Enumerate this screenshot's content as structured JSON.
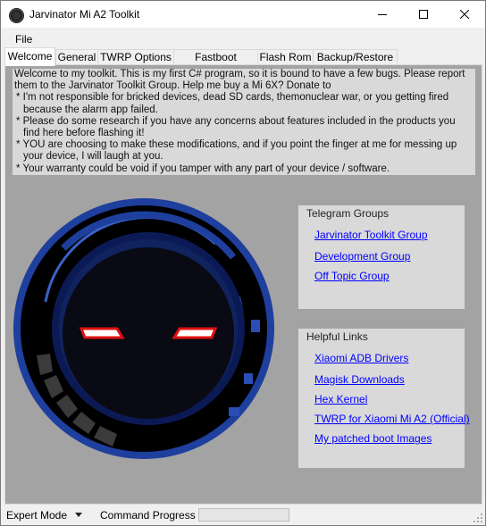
{
  "window": {
    "title": "Jarvinator Mi A2 Toolkit"
  },
  "menu": {
    "file": "File"
  },
  "tabs": [
    {
      "label": "Welcome",
      "active": true
    },
    {
      "label": "General"
    },
    {
      "label": "TWRP Options"
    },
    {
      "label": "Fastboot Flashing"
    },
    {
      "label": "Flash Rom"
    },
    {
      "label": "Backup/Restore"
    }
  ],
  "intro": {
    "p1": "Welcome to my toolkit. This is my first C# program, so it is bound to have a few bugs. Please report them to the Jarvinator Toolkit Group. Help me buy a Mi 6X? Donate to",
    "bullets": [
      "* I'm not responsible for bricked devices, dead SD cards, themonuclear war, or you getting fired because the alarm app failed.",
      "* Please do some research if you have any concerns about features included in the products you find here before flashing it!",
      "* YOU are choosing to make these modifications, and if you point the finger at me for messing up your device, I will laugh at you.",
      "* Your warranty could be void if you tamper with any part of your device / software."
    ]
  },
  "telegram": {
    "title": "Telegram Groups",
    "links": [
      "Jarvinator Toolkit Group",
      "Development Group",
      "Off Topic Group"
    ]
  },
  "helpful": {
    "title": "Helpful Links",
    "links": [
      "Xiaomi ADB Drivers",
      "Magisk Downloads",
      "Hex Kernel",
      "TWRP for Xiaomi Mi A2 (Official)",
      "My patched boot Images"
    ]
  },
  "status": {
    "mode": "Expert Mode",
    "command_label": "Command Progress",
    "progress": 0
  },
  "colors": {
    "link": "#0000ff",
    "panel_bg": "#a3a3a3",
    "box_bg": "#d9d9d9",
    "robot_blue": "#1e3f9e"
  }
}
